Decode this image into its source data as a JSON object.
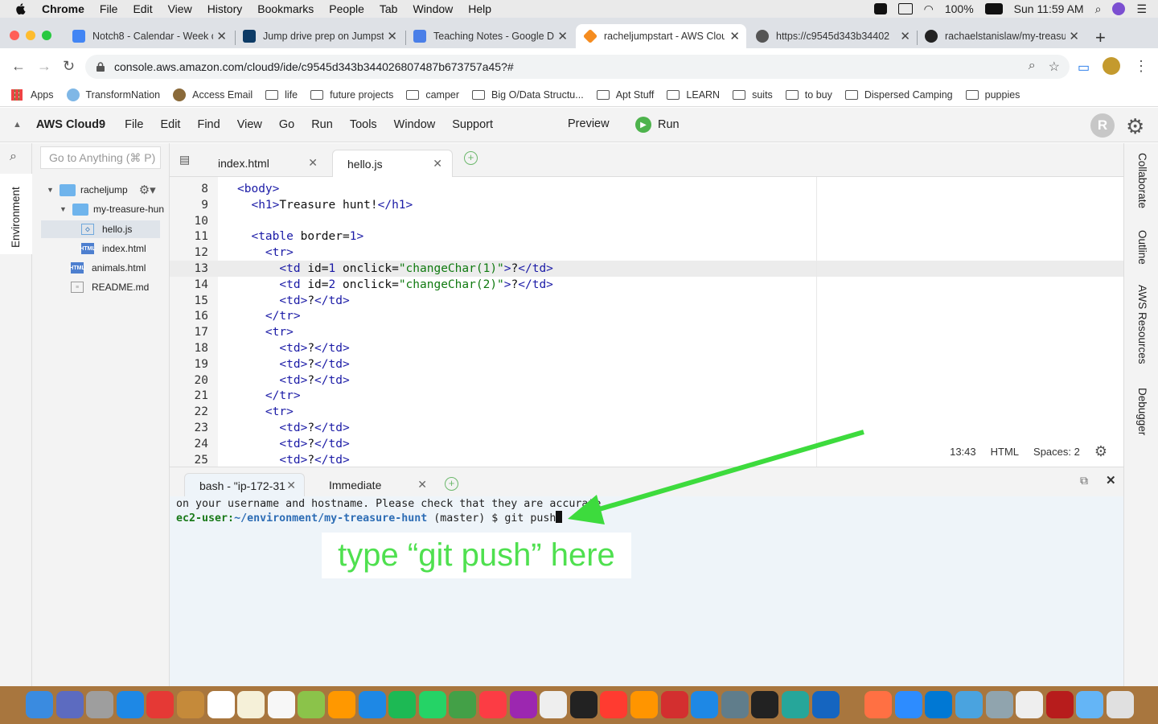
{
  "menubar": {
    "app": "Chrome",
    "items": [
      "File",
      "Edit",
      "View",
      "History",
      "Bookmarks",
      "People",
      "Tab",
      "Window",
      "Help"
    ],
    "battery": "100%",
    "clock": "Sun 11:59 AM"
  },
  "browser": {
    "tabs": [
      {
        "title": "Notch8 - Calendar - Week o",
        "icon": "calendar-icon",
        "color": "#4285f4"
      },
      {
        "title": "Jump drive prep on Jumpst",
        "icon": "trello-icon",
        "color": "#0d3b66"
      },
      {
        "title": "Teaching Notes - Google Do",
        "icon": "docs-icon",
        "color": "#4a7fe8"
      },
      {
        "title": "racheljumpstart - AWS Clou",
        "icon": "aws-icon",
        "color": "#f58c1f"
      },
      {
        "title": "https://c9545d343b34402",
        "icon": "globe-icon",
        "color": "#555555"
      },
      {
        "title": "rachaelstanislaw/my-treasu",
        "icon": "github-icon",
        "color": "#222222"
      }
    ],
    "url": "console.aws.amazon.com/cloud9/ide/c9545d343b344026807487b673757a45?#",
    "bookmarks": [
      {
        "label": "Apps",
        "type": "apps"
      },
      {
        "label": "TransformNation",
        "type": "site"
      },
      {
        "label": "Access Email",
        "type": "site"
      },
      {
        "label": "life",
        "type": "folder"
      },
      {
        "label": "future projects",
        "type": "folder"
      },
      {
        "label": "camper",
        "type": "folder"
      },
      {
        "label": "Big O/Data Structu...",
        "type": "folder"
      },
      {
        "label": "Apt Stuff",
        "type": "folder"
      },
      {
        "label": "LEARN",
        "type": "folder"
      },
      {
        "label": "suits",
        "type": "folder"
      },
      {
        "label": "to buy",
        "type": "folder"
      },
      {
        "label": "Dispersed Camping",
        "type": "folder"
      },
      {
        "label": "puppies",
        "type": "folder"
      }
    ]
  },
  "c9": {
    "brand": "AWS Cloud9",
    "menus": [
      "File",
      "Edit",
      "Find",
      "View",
      "Go",
      "Run",
      "Tools",
      "Window",
      "Support"
    ],
    "preview": "Preview",
    "run": "Run",
    "avatar": "R",
    "goto_placeholder": "Go to Anything (⌘ P)",
    "sidebar_label": "Environment",
    "tree": [
      {
        "label": "racheljump",
        "kind": "folder",
        "level": 0
      },
      {
        "label": "my-treasure-hun",
        "kind": "folder",
        "level": 1
      },
      {
        "label": "hello.js",
        "kind": "js",
        "level": 2
      },
      {
        "label": "index.html",
        "kind": "html",
        "level": 2
      },
      {
        "label": "animals.html",
        "kind": "html",
        "level": 1
      },
      {
        "label": "README.md",
        "kind": "md",
        "level": 1
      }
    ],
    "editor_tabs": [
      "index.html",
      "hello.js"
    ],
    "right_panels": [
      "Collaborate",
      "Outline",
      "AWS Resources",
      "Debugger"
    ],
    "status": {
      "pos": "13:43",
      "lang": "HTML",
      "spaces": "Spaces: 2"
    },
    "terminal_tabs": [
      "bash - \"ip-172-31",
      "Immediate"
    ],
    "terminal": {
      "line1": "on your username and hostname. Please check that they are accurate",
      "user": "ec2-user",
      "path": "~/environment/my-treasure-hunt",
      "branch": " (master) $ ",
      "command": "git push"
    },
    "annotation": "type “git push” here",
    "annotation_color": "#4fe04f"
  },
  "code_lines": [
    {
      "n": "8",
      "html": "<span class='tag'>&lt;body&gt;</span>"
    },
    {
      "n": "9",
      "html": "  <span class='tag'>&lt;h1&gt;</span>Treasure hunt!<span class='tag'>&lt;/h1&gt;</span>"
    },
    {
      "n": "10",
      "html": ""
    },
    {
      "n": "11",
      "html": "  <span class='tag'>&lt;table</span> border=<span class='num'>1</span><span class='tag'>&gt;</span>"
    },
    {
      "n": "12",
      "html": "    <span class='tag'>&lt;tr&gt;</span>"
    },
    {
      "n": "13",
      "html": "      <span class='tag'>&lt;td</span> id=<span class='num'>1</span> onclick=<span class='str'>\"changeChar(1)\"</span><span class='tag'>&gt;</span>?<span class='tag'>&lt;/td&gt;</span>"
    },
    {
      "n": "14",
      "html": "      <span class='tag'>&lt;td</span> id=<span class='num'>2</span> onclick=<span class='str'>\"changeChar(2)\"</span><span class='tag'>&gt;</span>?<span class='tag'>&lt;/td&gt;</span>"
    },
    {
      "n": "15",
      "html": "      <span class='tag'>&lt;td&gt;</span>?<span class='tag'>&lt;/td&gt;</span>"
    },
    {
      "n": "16",
      "html": "    <span class='tag'>&lt;/tr&gt;</span>"
    },
    {
      "n": "17",
      "html": "    <span class='tag'>&lt;tr&gt;</span>"
    },
    {
      "n": "18",
      "html": "      <span class='tag'>&lt;td&gt;</span>?<span class='tag'>&lt;/td&gt;</span>"
    },
    {
      "n": "19",
      "html": "      <span class='tag'>&lt;td&gt;</span>?<span class='tag'>&lt;/td&gt;</span>"
    },
    {
      "n": "20",
      "html": "      <span class='tag'>&lt;td&gt;</span>?<span class='tag'>&lt;/td&gt;</span>"
    },
    {
      "n": "21",
      "html": "    <span class='tag'>&lt;/tr&gt;</span>"
    },
    {
      "n": "22",
      "html": "    <span class='tag'>&lt;tr&gt;</span>"
    },
    {
      "n": "23",
      "html": "      <span class='tag'>&lt;td&gt;</span>?<span class='tag'>&lt;/td&gt;</span>"
    },
    {
      "n": "24",
      "html": "      <span class='tag'>&lt;td&gt;</span>?<span class='tag'>&lt;/td&gt;</span>"
    },
    {
      "n": "25",
      "html": "      <span class='tag'>&lt;td&gt;</span>?<span class='tag'>&lt;/td&gt;</span>"
    }
  ],
  "dock_colors": [
    "#3a8be0",
    "#5c6bc0",
    "#9e9e9e",
    "#1e88e5",
    "#e53935",
    "#c58a3a",
    "#ffffff",
    "#f5f0d8",
    "#f7f7f7",
    "#8bc34a",
    "#ff9800",
    "#1e88e5",
    "#1db954",
    "#25d366",
    "#43a047",
    "#fc3c44",
    "#9c27b0",
    "#eeeeee",
    "#222222",
    "#ff3b30",
    "#ff9500",
    "#d32f2f",
    "#1e88e5",
    "#607d8b",
    "#222222",
    "#26a69a",
    "#1565c0",
    "#ff7043",
    "#2d8cff",
    "#0078d4",
    "#4aa3df",
    "#90a4ae",
    "#eeeeee",
    "#b71c1c",
    "#64b5f6",
    "#e0e0e0"
  ]
}
